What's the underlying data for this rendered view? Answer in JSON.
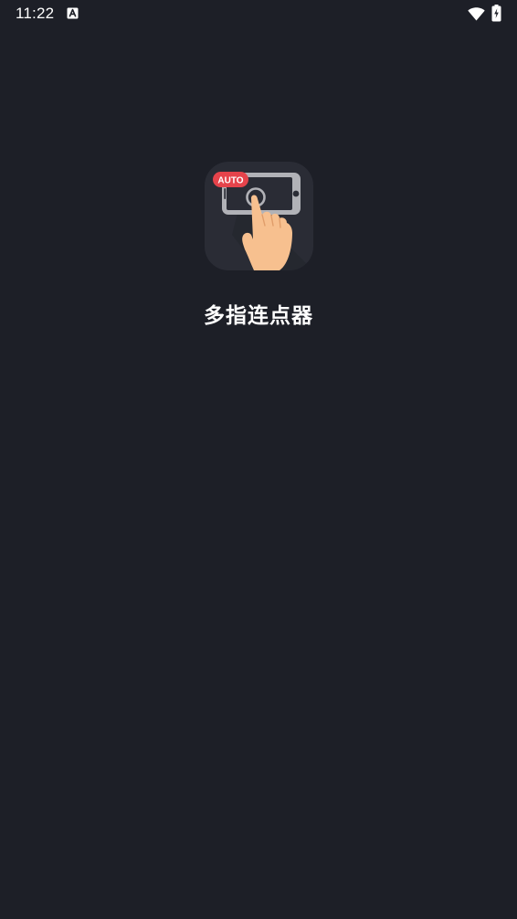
{
  "status_bar": {
    "time": "11:22",
    "icons": [
      "notification-a-icon",
      "wifi-icon",
      "battery-charging-icon"
    ]
  },
  "splash": {
    "app_name": "多指连点器",
    "icon": {
      "name": "auto-clicker-app-icon",
      "badge_text": "AUTO",
      "badge_color": "#e5434b",
      "tile_color": "#2a2c35",
      "phone_frame_color": "#b1b2b7",
      "finger_color": "#f7c08f"
    }
  },
  "colors": {
    "background": "#1d1f27",
    "text": "#ffffff"
  }
}
